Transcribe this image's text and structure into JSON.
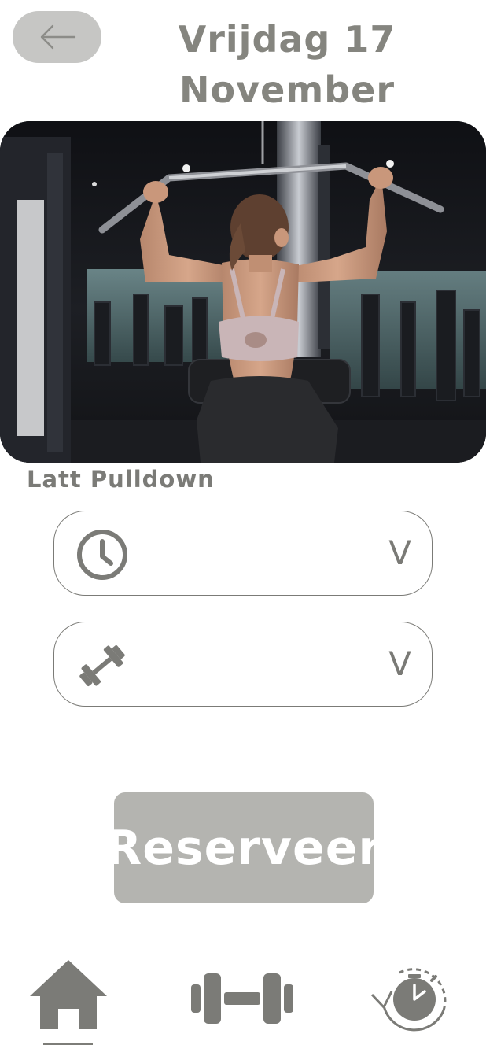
{
  "header": {
    "back_icon": "arrow-left-icon",
    "date_line1": "Vrijdag 17",
    "date_line2": "November"
  },
  "exercise": {
    "name": "Latt Pulldown",
    "image": "woman-lat-pulldown-gym-photo"
  },
  "fields": [
    {
      "icon": "clock-icon",
      "value": "",
      "chevron": "V"
    },
    {
      "icon": "dumbbell-icon",
      "value": "",
      "chevron": "V"
    }
  ],
  "actions": {
    "reserve_label": "Reserveer"
  },
  "bottom_nav": {
    "items": [
      {
        "icon": "home-icon",
        "active": true
      },
      {
        "icon": "dumbbell-icon",
        "active": false
      },
      {
        "icon": "history-clock-icon",
        "active": false
      }
    ]
  },
  "colors": {
    "text": "#85857f",
    "button_bg": "#b4b4b0",
    "back_bg": "#c6c6c4",
    "icon": "#7b7b77"
  }
}
